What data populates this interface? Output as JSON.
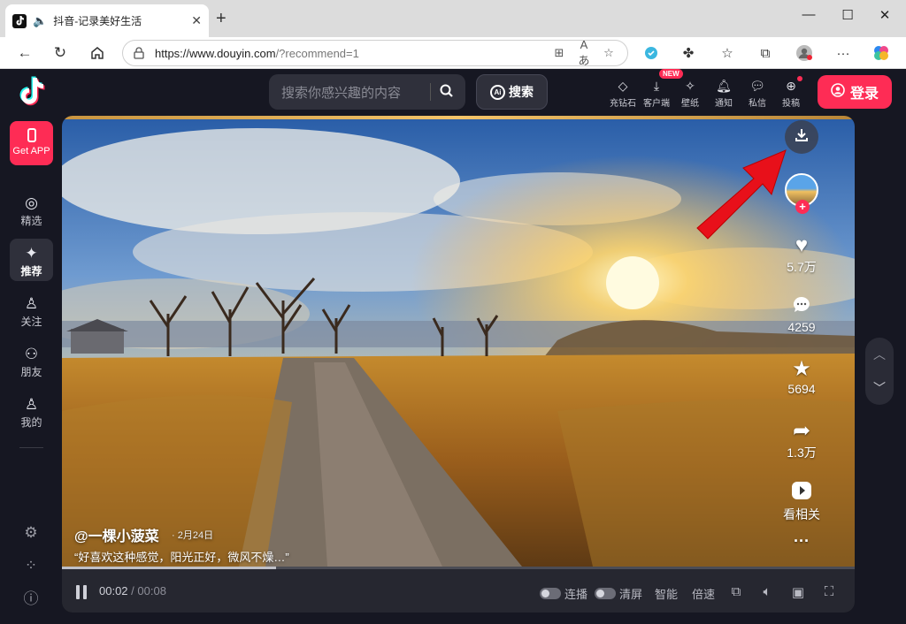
{
  "browser": {
    "tab_title": "抖音-记录美好生活",
    "tab_close": "✕",
    "new_tab": "+",
    "window_controls": {
      "minimize": "—",
      "maximize": "☐",
      "close": "✕"
    },
    "url_host": "https://www.douyin.com",
    "url_path": "/?recommend=1"
  },
  "header": {
    "search_placeholder": "搜索你感兴趣的内容",
    "ai_badge": "Ai",
    "ai_search_label": "搜索",
    "icons": [
      {
        "name": "充钻石",
        "icon": "diamond-icon"
      },
      {
        "name": "客户端",
        "icon": "download-client-icon"
      },
      {
        "name": "壁纸",
        "icon": "wallpaper-icon"
      },
      {
        "name": "通知",
        "icon": "bell-icon"
      },
      {
        "name": "私信",
        "icon": "message-icon"
      },
      {
        "name": "投稿",
        "icon": "upload-icon"
      }
    ],
    "new_badge": "NEW",
    "login_label": "登录"
  },
  "sidebar": {
    "get_app": "Get APP",
    "items": [
      {
        "label": "精选",
        "icon": "featured-icon"
      },
      {
        "label": "推荐",
        "icon": "recommend-icon",
        "active": true
      },
      {
        "label": "关注",
        "icon": "follow-icon"
      },
      {
        "label": "朋友",
        "icon": "friends-icon"
      },
      {
        "label": "我的",
        "icon": "profile-icon"
      }
    ]
  },
  "video": {
    "author": "@一棵小菠菜",
    "date": "· 2月24日",
    "caption": "“好喜欢这种感觉，阳光正好，微风不燥…”",
    "likes": "5.7万",
    "comments": "4259",
    "favorites": "5694",
    "shares": "1.3万",
    "related_label": "看相关",
    "more": "···",
    "time_current": "00:02",
    "time_total": "/ 00:08",
    "progress": 0.27,
    "controls": {
      "continuous": "连播",
      "clear": "清屏",
      "smart": "智能",
      "speed": "倍速"
    }
  },
  "colors": {
    "brand": "#fe2c55",
    "page_bg": "#161722",
    "panel": "#2f303b"
  }
}
